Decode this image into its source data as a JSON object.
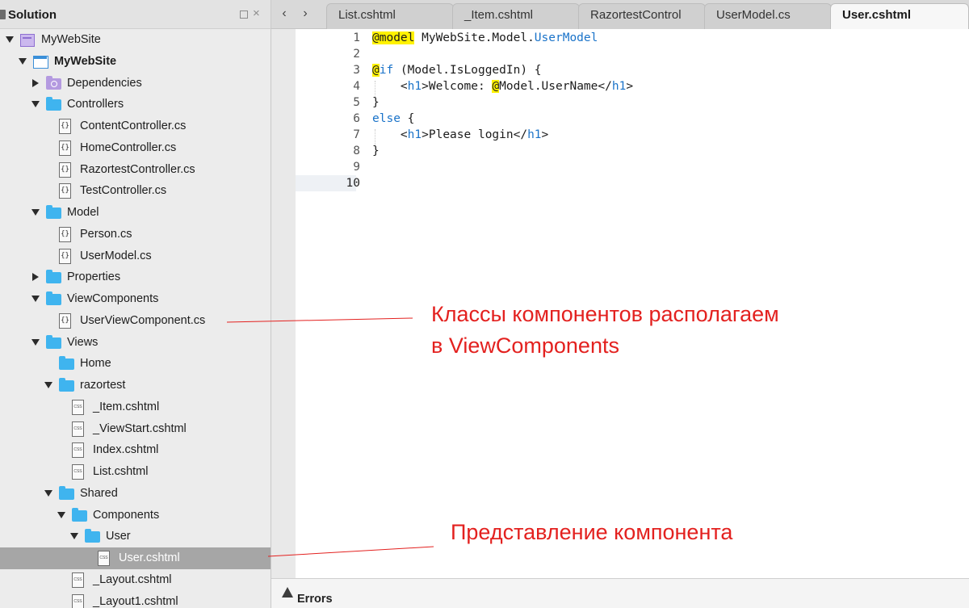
{
  "solution_pane": {
    "title": "Solution",
    "pin_icon": "pin-icon",
    "close_label": "×"
  },
  "tree": [
    {
      "label": "MyWebSite",
      "icon": "solution-icon",
      "expanded": true,
      "bold": false
    },
    {
      "label": "MyWebSite",
      "icon": "project-icon",
      "expanded": true,
      "bold": true
    },
    {
      "label": "Dependencies",
      "icon": "dependencies-folder-icon",
      "expanded": false
    },
    {
      "label": "Controllers",
      "icon": "folder-icon",
      "expanded": true
    },
    {
      "label": "ContentController.cs",
      "icon": "cs-file-icon"
    },
    {
      "label": "HomeController.cs",
      "icon": "cs-file-icon"
    },
    {
      "label": "RazortestController.cs",
      "icon": "cs-file-icon"
    },
    {
      "label": "TestController.cs",
      "icon": "cs-file-icon"
    },
    {
      "label": "Model",
      "icon": "folder-icon",
      "expanded": true
    },
    {
      "label": "Person.cs",
      "icon": "cs-file-icon"
    },
    {
      "label": "UserModel.cs",
      "icon": "cs-file-icon"
    },
    {
      "label": "Properties",
      "icon": "folder-icon",
      "expanded": false
    },
    {
      "label": "ViewComponents",
      "icon": "folder-icon",
      "expanded": true
    },
    {
      "label": "UserViewComponent.cs",
      "icon": "cs-file-icon"
    },
    {
      "label": "Views",
      "icon": "folder-icon",
      "expanded": true
    },
    {
      "label": "Home",
      "icon": "folder-icon"
    },
    {
      "label": "razortest",
      "icon": "folder-icon",
      "expanded": true
    },
    {
      "label": "_Item.cshtml",
      "icon": "cshtml-file-icon"
    },
    {
      "label": "_ViewStart.cshtml",
      "icon": "cshtml-file-icon"
    },
    {
      "label": "Index.cshtml",
      "icon": "cshtml-file-icon"
    },
    {
      "label": "List.cshtml",
      "icon": "cshtml-file-icon"
    },
    {
      "label": "Shared",
      "icon": "folder-icon",
      "expanded": true
    },
    {
      "label": "Components",
      "icon": "folder-icon",
      "expanded": true
    },
    {
      "label": "User",
      "icon": "folder-icon",
      "expanded": true
    },
    {
      "label": "User.cshtml",
      "icon": "cshtml-file-icon",
      "selected": true
    },
    {
      "label": "_Layout.cshtml",
      "icon": "cshtml-file-icon"
    },
    {
      "label": "_Layout1.cshtml",
      "icon": "cshtml-file-icon"
    }
  ],
  "tabs": [
    {
      "label": "List.cshtml",
      "active": false
    },
    {
      "label": "_Item.cshtml",
      "active": false
    },
    {
      "label": "RazortestControl",
      "active": false
    },
    {
      "label": "UserModel.cs",
      "active": false
    },
    {
      "label": "User.cshtml",
      "active": true
    }
  ],
  "nav": {
    "back": "‹",
    "forward": "›"
  },
  "editor": {
    "line_numbers": [
      "1",
      "2",
      "3",
      "4",
      "5",
      "6",
      "7",
      "8",
      "9",
      "10"
    ],
    "current_line": "10",
    "lines": [
      {
        "num": "1",
        "parts": [
          {
            "t": "@model",
            "c": "hl"
          },
          {
            "t": " MyWebSite.Model.",
            "c": ""
          },
          {
            "t": "UserModel",
            "c": "kw"
          }
        ]
      },
      {
        "num": "2",
        "parts": []
      },
      {
        "num": "3",
        "parts": [
          {
            "t": "@",
            "c": "hl"
          },
          {
            "t": "if",
            "c": "kw"
          },
          {
            "t": " (Model.IsLoggedIn) {",
            "c": ""
          }
        ]
      },
      {
        "num": "4",
        "parts": [
          {
            "t": "    <",
            "c": ""
          },
          {
            "t": "h1",
            "c": "tag"
          },
          {
            "t": ">Welcome: ",
            "c": ""
          },
          {
            "t": "@",
            "c": "hl"
          },
          {
            "t": "Model.UserName</",
            "c": ""
          },
          {
            "t": "h1",
            "c": "tag"
          },
          {
            "t": ">",
            "c": ""
          }
        ]
      },
      {
        "num": "5",
        "parts": [
          {
            "t": "}",
            "c": ""
          }
        ]
      },
      {
        "num": "6",
        "parts": [
          {
            "t": "else",
            "c": "kw"
          },
          {
            "t": " {",
            "c": ""
          }
        ]
      },
      {
        "num": "7",
        "parts": [
          {
            "t": "    <",
            "c": ""
          },
          {
            "t": "h1",
            "c": "tag"
          },
          {
            "t": ">Please login</",
            "c": ""
          },
          {
            "t": "h1",
            "c": "tag"
          },
          {
            "t": ">",
            "c": ""
          }
        ]
      },
      {
        "num": "8",
        "parts": [
          {
            "t": "}",
            "c": ""
          }
        ]
      },
      {
        "num": "9",
        "parts": []
      },
      {
        "num": "10",
        "parts": []
      }
    ]
  },
  "bottom_pad": {
    "errors_label": "Errors",
    "icon": "warning-icon"
  },
  "annotations": {
    "components_note_line1": "Классы компонентов располагаем",
    "components_note_line2": "в ViewComponents",
    "view_note": "Представление компонента",
    "color": "#e3211f"
  }
}
